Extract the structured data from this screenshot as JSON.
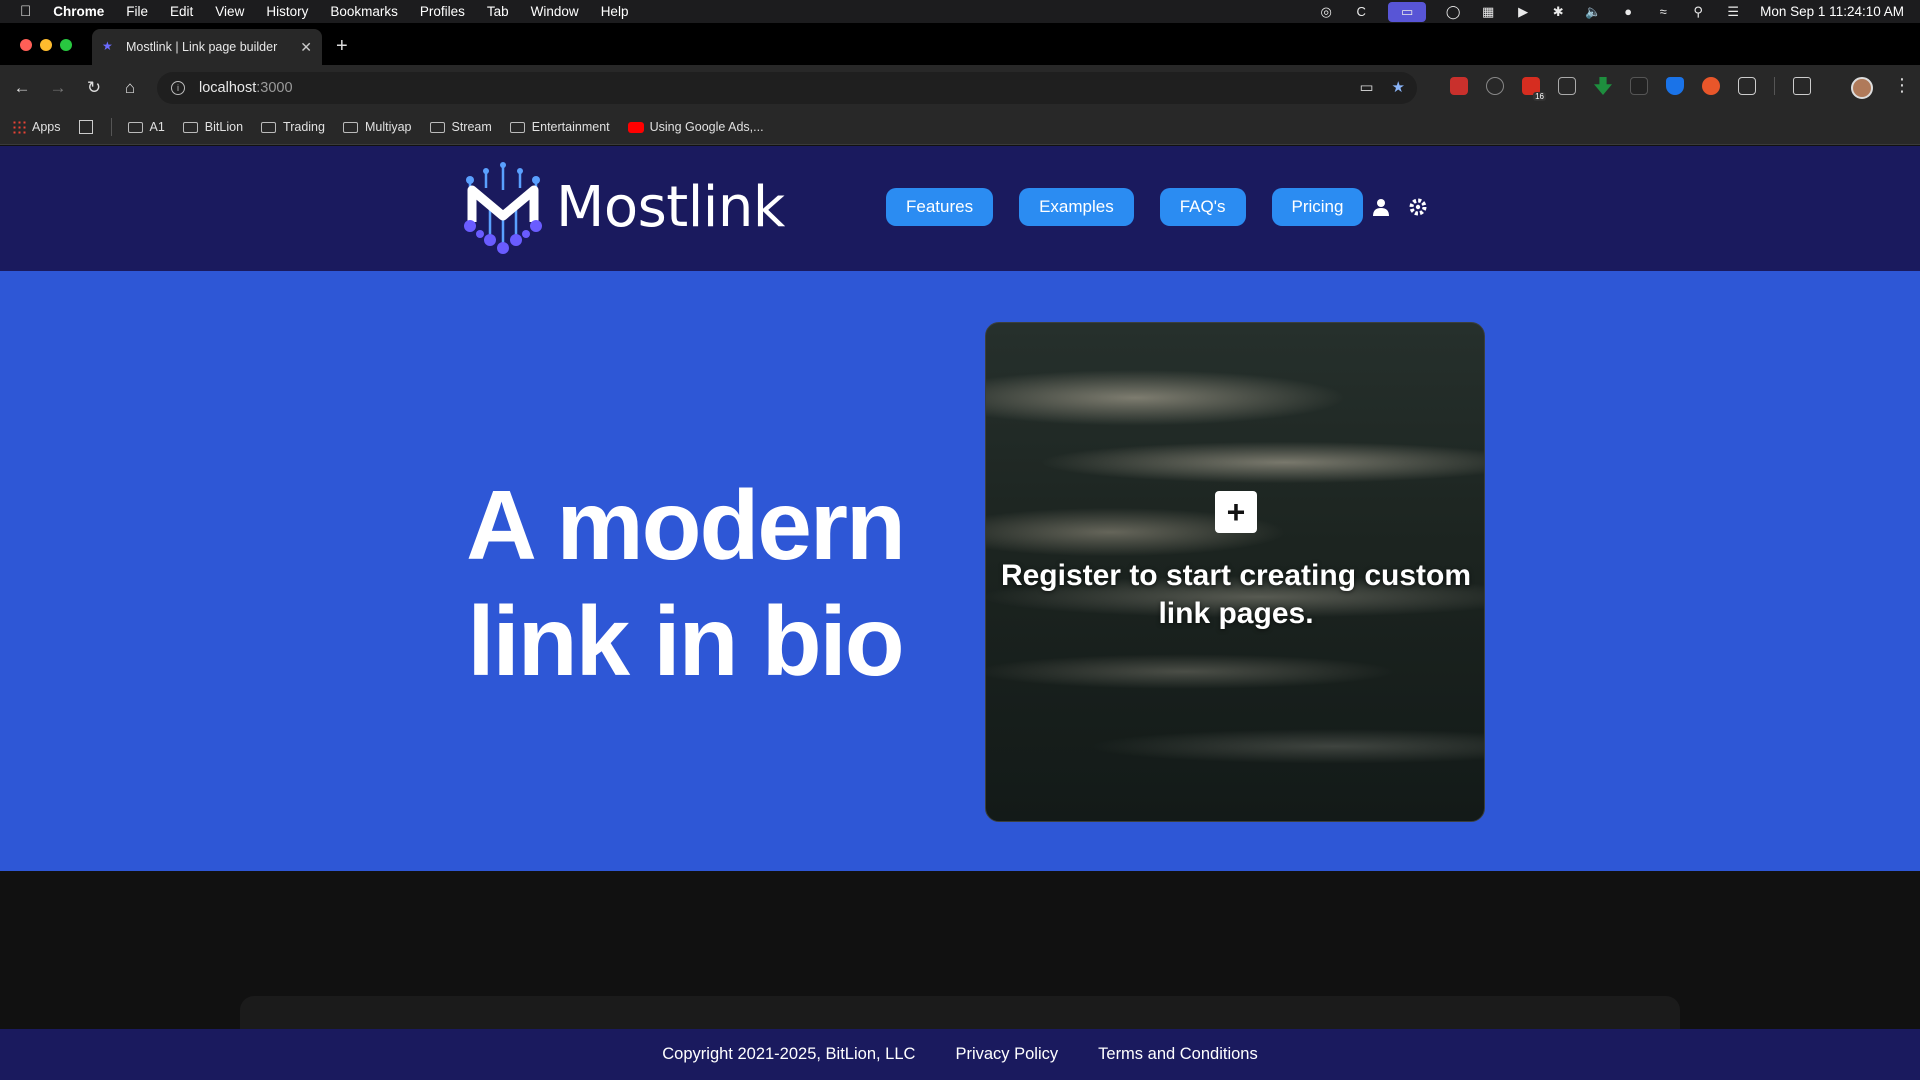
{
  "menubar": {
    "apple_icon": "apple-logo",
    "app_name": "Chrome",
    "menus": [
      "File",
      "Edit",
      "View",
      "History",
      "Bookmarks",
      "Profiles",
      "Tab",
      "Window",
      "Help"
    ],
    "clock": "Mon Sep 1  11:24:10 AM"
  },
  "browser": {
    "tab_title": "Mostlink | Link page builder",
    "url_host": "localhost",
    "url_port": ":3000",
    "bookmarks": [
      "Apps",
      "A1",
      "BitLion",
      "Trading",
      "Multiyap",
      "Stream",
      "Entertainment",
      "Using Google Ads,..."
    ],
    "extension_badge": "16"
  },
  "site": {
    "brand": "Mostlink",
    "nav": [
      "Features",
      "Examples",
      "FAQ's",
      "Pricing"
    ],
    "hero_line1": "A modern",
    "hero_line2": "link in bio",
    "card_text": "Register to start creating custom link pages.",
    "footer": {
      "copyright": "Copyright 2021-2025, BitLion, LLC",
      "privacy": "Privacy Policy",
      "terms": "Terms and Conditions"
    }
  },
  "colors": {
    "header_bg": "#1a1a5e",
    "hero_bg": "#2e57d6",
    "nav_pill": "#2b8cf2",
    "page_dark": "#111111"
  }
}
